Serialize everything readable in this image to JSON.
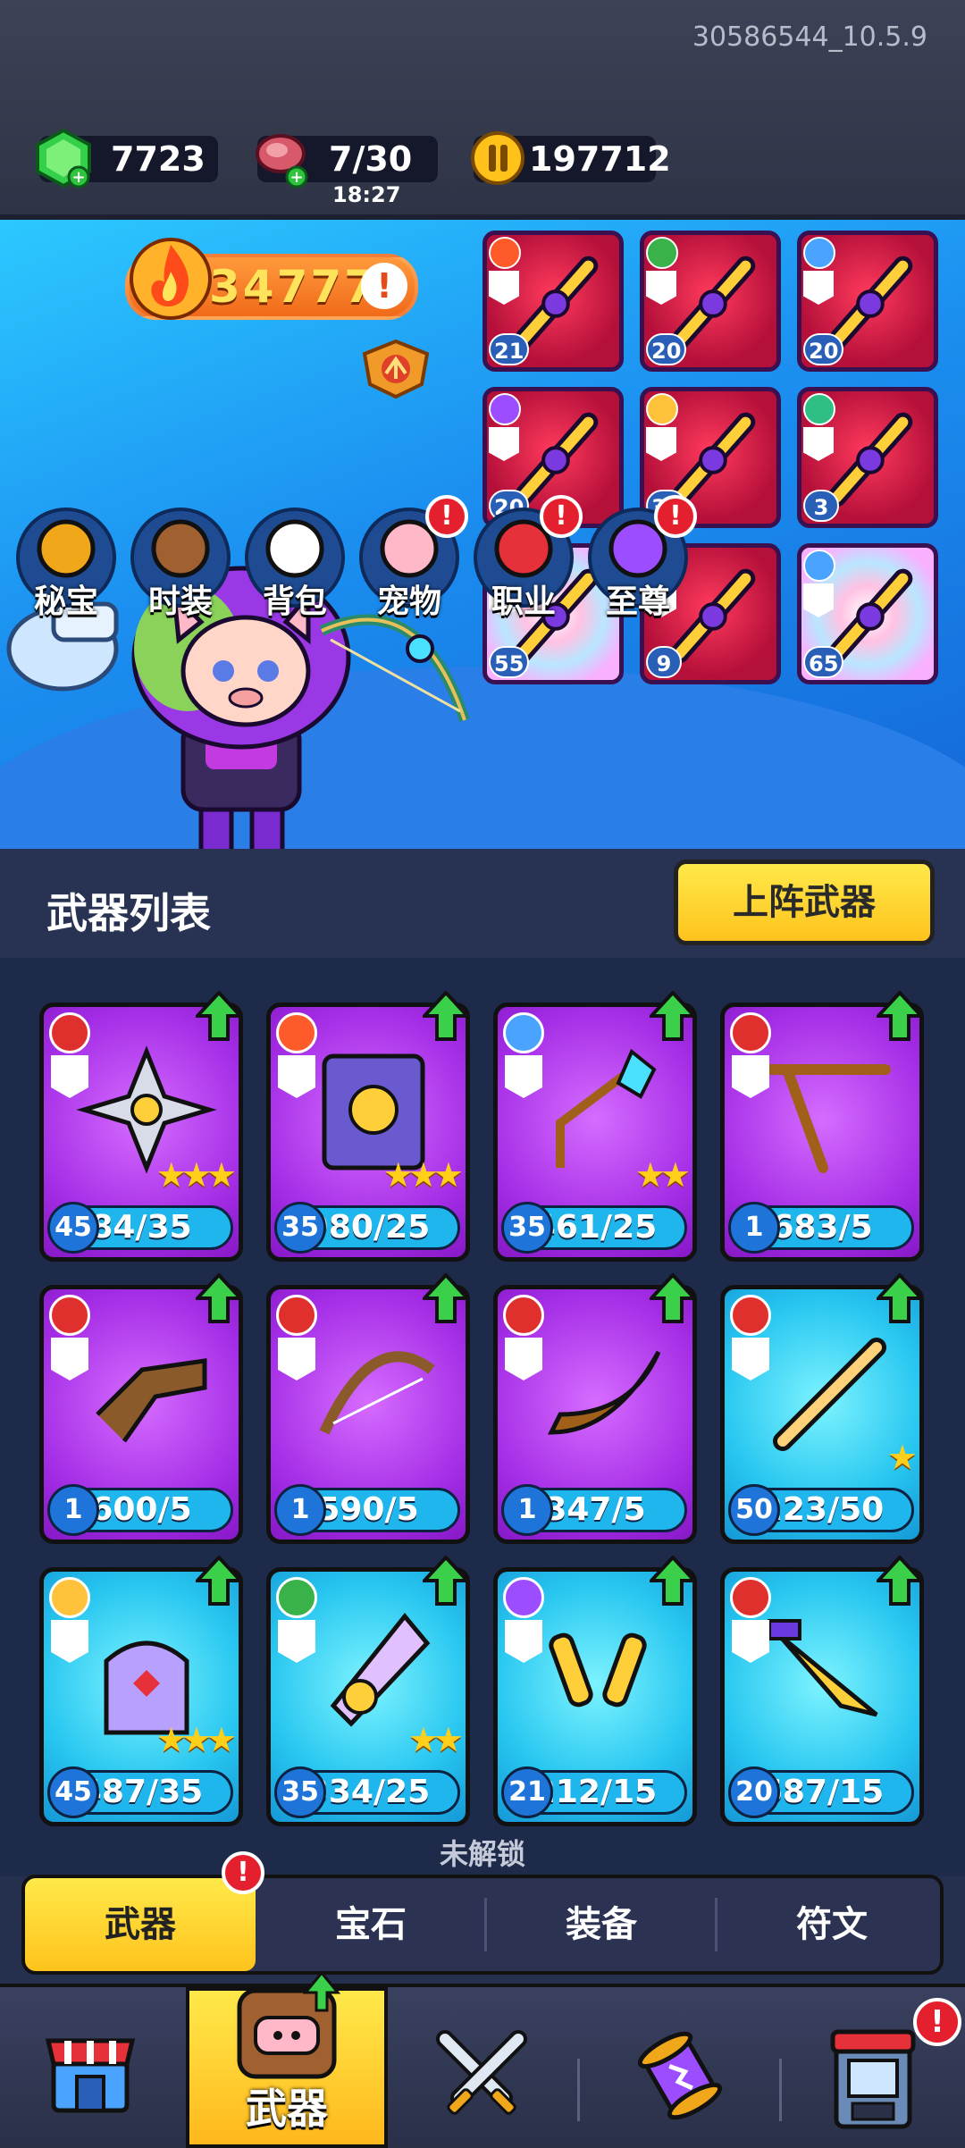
{
  "build_id": "30586544_10.5.9",
  "resources": {
    "gems": "7723",
    "energy": "7/30",
    "energy_timer": "18:27",
    "coins": "197712"
  },
  "hero": {
    "power": "34777"
  },
  "equipped_weapons": [
    {
      "level": "21",
      "bg": "red",
      "element": "#ff5a2a"
    },
    {
      "level": "20",
      "bg": "red",
      "element": "#39b24a"
    },
    {
      "level": "20",
      "bg": "red",
      "element": "#4aa3ff"
    },
    {
      "level": "20",
      "bg": "red",
      "element": "#9b4dff"
    },
    {
      "level": "35",
      "bg": "red",
      "element": "#ffc23a"
    },
    {
      "level": "3",
      "bg": "red",
      "element": "#2fbf84"
    },
    {
      "level": "55",
      "bg": "rainbow",
      "element": "#ff5a2a"
    },
    {
      "level": "9",
      "bg": "red",
      "element": "#ffc23a"
    },
    {
      "level": "65",
      "bg": "rainbow",
      "element": "#4aa3ff"
    }
  ],
  "features": [
    {
      "label": "秘宝",
      "badge": ""
    },
    {
      "label": "时装",
      "badge": ""
    },
    {
      "label": "背包",
      "badge": ""
    },
    {
      "label": "宠物",
      "badge": "!"
    },
    {
      "label": "职业",
      "badge": "!"
    },
    {
      "label": "至尊",
      "badge": "!"
    }
  ],
  "list": {
    "title": "武器列表",
    "deploy_button": "上阵武器"
  },
  "weapons": [
    {
      "level": "45",
      "count": "84/35",
      "stars": "★★★",
      "theme": "violet",
      "element": "#e0302e"
    },
    {
      "level": "35",
      "count": "980/25",
      "stars": "★★★",
      "theme": "violet",
      "element": "#ff5a2a"
    },
    {
      "level": "35",
      "count": "461/25",
      "stars": "★★",
      "theme": "violet",
      "element": "#4aa3ff"
    },
    {
      "level": "1",
      "count": "683/5",
      "stars": "",
      "theme": "violet",
      "element": "#e0302e"
    },
    {
      "level": "1",
      "count": "600/5",
      "stars": "",
      "theme": "violet",
      "element": "#e0302e"
    },
    {
      "level": "1",
      "count": "590/5",
      "stars": "",
      "theme": "violet",
      "element": "#e0302e"
    },
    {
      "level": "1",
      "count": "347/5",
      "stars": "",
      "theme": "violet",
      "element": "#e0302e"
    },
    {
      "level": "50",
      "count": "223/50",
      "stars": "★",
      "theme": "cyan",
      "element": "#e0302e"
    },
    {
      "level": "45",
      "count": "487/35",
      "stars": "★★★",
      "theme": "cyan",
      "element": "#ffc23a"
    },
    {
      "level": "35",
      "count": "334/25",
      "stars": "★★",
      "theme": "cyan",
      "element": "#39b24a"
    },
    {
      "level": "21",
      "count": "212/15",
      "stars": "",
      "theme": "cyan",
      "element": "#9b4dff"
    },
    {
      "level": "20",
      "count": "687/15",
      "stars": "",
      "theme": "cyan",
      "element": "#e0302e"
    }
  ],
  "locked_label": "未解锁",
  "category_tabs": [
    "武器",
    "宝石",
    "装备",
    "符文"
  ],
  "category_badge": "!",
  "bottom_nav": {
    "active_label": "武器",
    "shop_badge": "!"
  }
}
